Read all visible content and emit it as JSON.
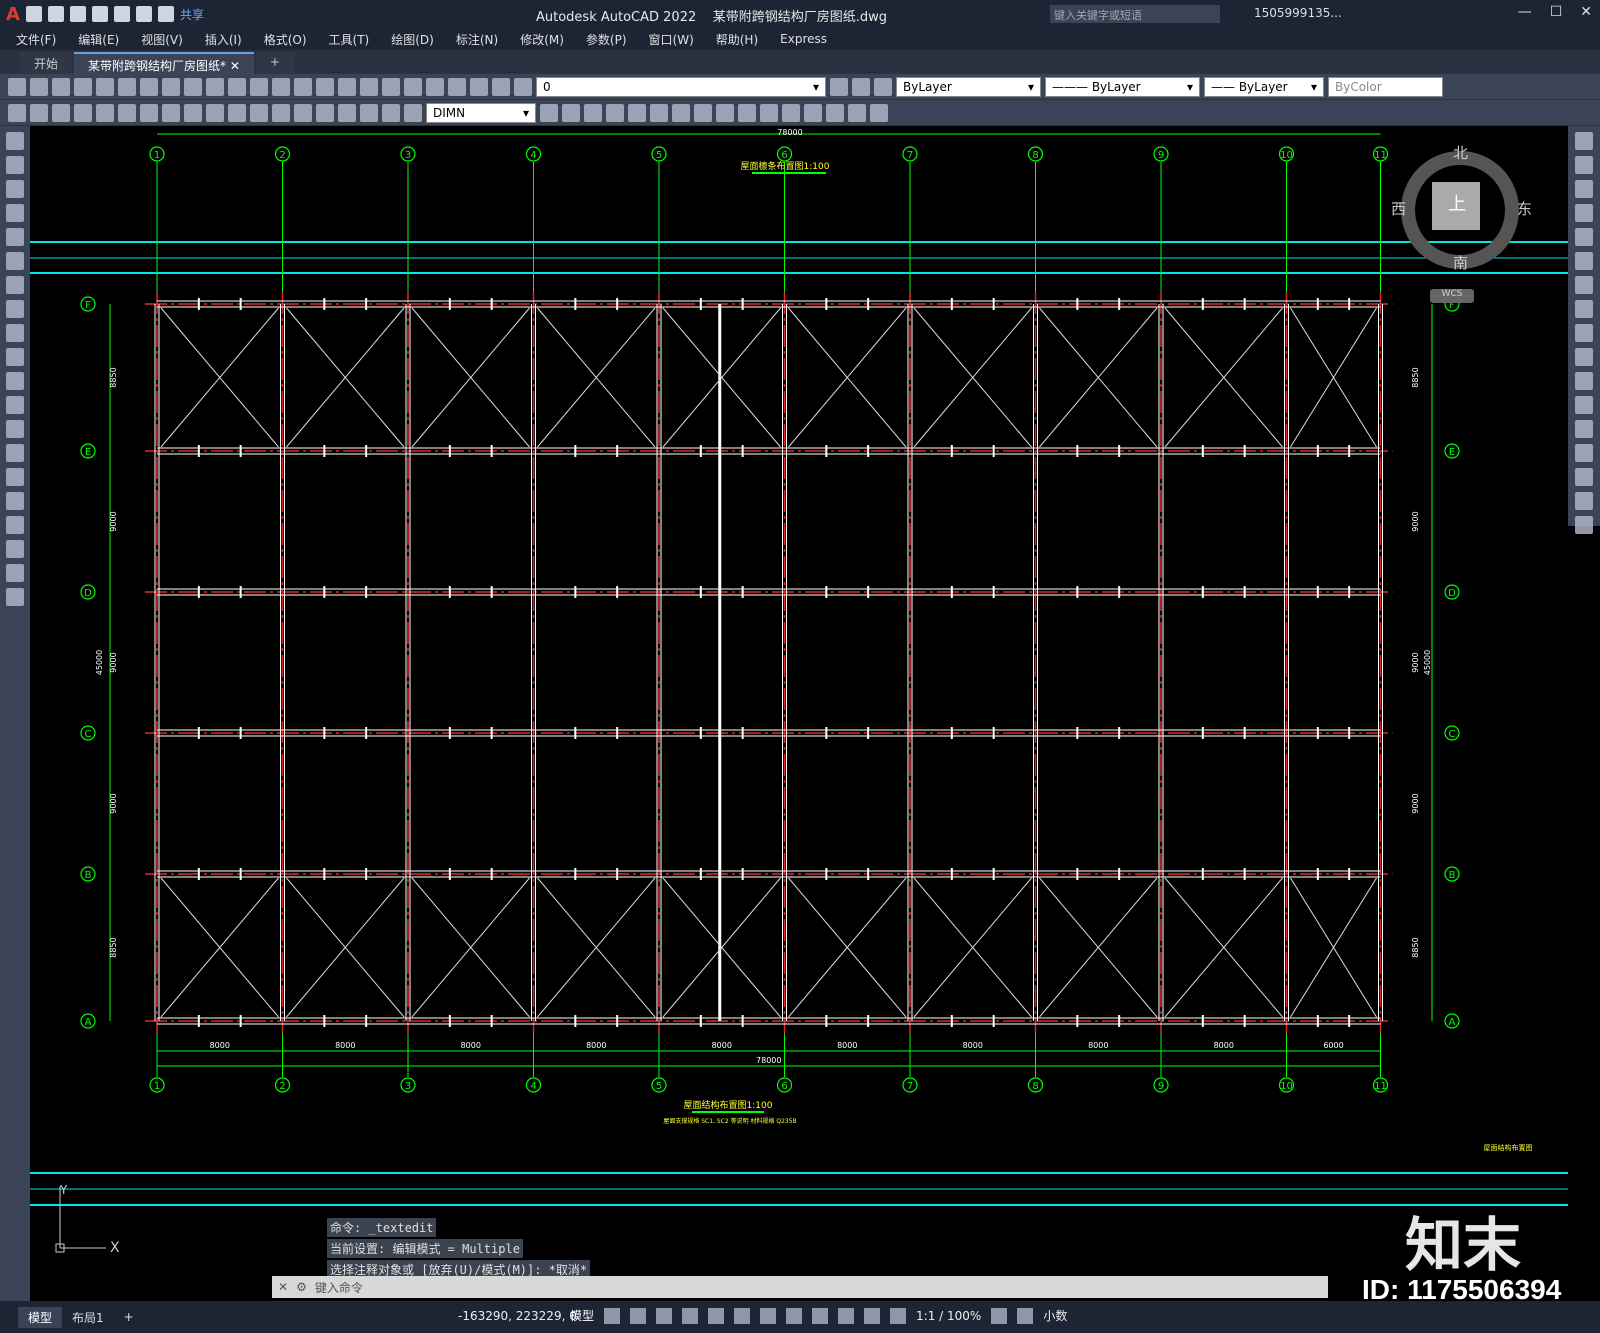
{
  "title": {
    "app": "Autodesk AutoCAD 2022",
    "file": "某带附跨钢结构厂房图纸.dwg",
    "share": "共享",
    "search_placeholder": "键入关键字或短语",
    "user": "1505999135..."
  },
  "menu": [
    "文件(F)",
    "编辑(E)",
    "视图(V)",
    "插入(I)",
    "格式(O)",
    "工具(T)",
    "绘图(D)",
    "标注(N)",
    "修改(M)",
    "参数(P)",
    "窗口(W)",
    "帮助(H)",
    "Express"
  ],
  "tabs": {
    "start": "开始",
    "doc": "某带附跨钢结构厂房图纸*"
  },
  "toolbar": {
    "layer": "0",
    "color": "ByLayer",
    "linetype": "ByLayer",
    "lineweight": "ByLayer",
    "plotstyle": "ByColor",
    "dimstyle": "DIMN"
  },
  "viewcube": {
    "north": "北",
    "south": "南",
    "east": "东",
    "west": "西",
    "face": "上",
    "wcs": "WCS"
  },
  "drawing": {
    "top_title": "屋面檩条布置图1:100",
    "bottom_title": "屋面结构布置图1:100",
    "note": "屋面支撑规格 SC1, SC2 等说明 材料规格 Q235B",
    "corner_label": "屋面结构布置图",
    "total_dim": "78000",
    "height_dim": "45000",
    "col_labels": [
      "1",
      "2",
      "3",
      "4",
      "5",
      "6",
      "7",
      "8",
      "9",
      "10",
      "11"
    ],
    "row_labels": [
      "F",
      "E",
      "D",
      "C",
      "B",
      "A"
    ],
    "bay_dims": [
      "8000",
      "8000",
      "8000",
      "8000",
      "8000",
      "8000",
      "8000",
      "8000",
      "8000",
      "6000"
    ],
    "row_dims": [
      "8850",
      "9000",
      "9000",
      "9000",
      "8850"
    ]
  },
  "command": {
    "line1": "命令: _textedit",
    "line2": "当前设置: 编辑模式 = Multiple",
    "line3": "选择注释对象或 [放弃(U)/模式(M)]: *取消*",
    "placeholder": "键入命令"
  },
  "status": {
    "model_tab": "模型",
    "layout_tab": "布局1",
    "coords": "-163290, 223229, 0",
    "model": "模型",
    "scale": "1:1 / 100%",
    "units": "小数"
  },
  "watermark": {
    "id": "ID: 1175506394",
    "logo": "知末"
  }
}
